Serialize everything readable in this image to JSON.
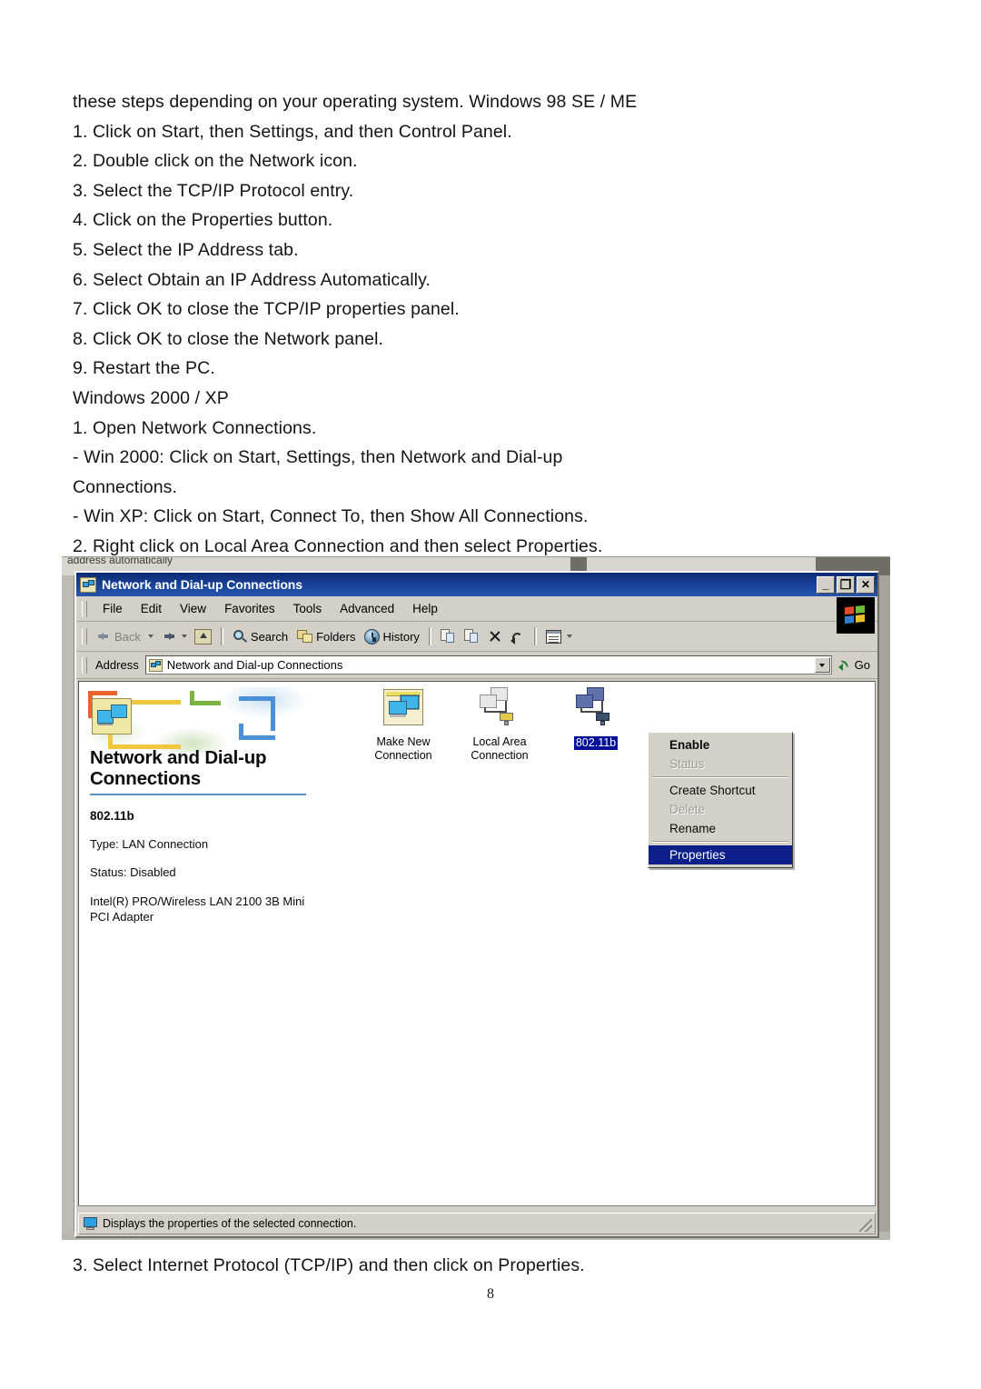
{
  "document": {
    "lines_top": [
      "these steps depending on your operating system. Windows 98 SE / ME",
      "1. Click on Start, then Settings, and then Control Panel.",
      "2. Double click on the Network icon.",
      "3. Select the TCP/IP Protocol entry.",
      "4. Click on the Properties button.",
      "5. Select the IP Address tab.",
      "6. Select Obtain an IP Address Automatically.",
      "7. Click OK to close the TCP/IP properties panel.",
      "8. Click OK to close the Network panel.",
      "9. Restart the PC.",
      "Windows 2000 / XP",
      "1. Open Network Connections.",
      "- Win 2000: Click on Start, Settings, then Network and Dial-up",
      "Connections.",
      "- Win XP: Click on Start, Connect To, then Show All Connections.",
      "2. Right click on Local Area Connection and then select Properties."
    ],
    "lines_bottom": [
      "3. Select Internet Protocol (TCP/IP) and then click on Properties."
    ],
    "page_number": "8"
  },
  "background_window": {
    "fragment_text": "address automatically"
  },
  "window": {
    "title": "Network and Dial-up Connections",
    "title_icon": "network-connections-icon",
    "controls": {
      "minimize": "_",
      "maximize": "❐",
      "close": "✕"
    },
    "menu": [
      {
        "label": "File"
      },
      {
        "label": "Edit"
      },
      {
        "label": "View"
      },
      {
        "label": "Favorites"
      },
      {
        "label": "Tools"
      },
      {
        "label": "Advanced"
      },
      {
        "label": "Help"
      }
    ],
    "toolbar": {
      "back": "Back",
      "search": "Search",
      "folders": "Folders",
      "history": "History"
    },
    "address": {
      "label": "Address",
      "value": "Network and Dial-up Connections",
      "go": "Go"
    },
    "left_pane": {
      "banner_title": "Network and Dial-up Connections",
      "detail_title": "802.11b",
      "detail_type": "Type: LAN Connection",
      "detail_status": "Status: Disabled",
      "detail_adapter": "Intel(R) PRO/Wireless LAN 2100 3B Mini PCI Adapter"
    },
    "connections": [
      {
        "name": "Make New Connection",
        "selected": false
      },
      {
        "name": "Local Area Connection",
        "selected": false
      },
      {
        "name": "802.11b",
        "selected": true
      }
    ],
    "context_menu": [
      {
        "label": "Enable",
        "state": "bold"
      },
      {
        "label": "Status",
        "state": "disabled"
      },
      {
        "label": "separator",
        "state": "separator"
      },
      {
        "label": "Create Shortcut",
        "state": "normal"
      },
      {
        "label": "Delete",
        "state": "disabled"
      },
      {
        "label": "Rename",
        "state": "normal"
      },
      {
        "label": "separator",
        "state": "separator"
      },
      {
        "label": "Properties",
        "state": "highlight"
      }
    ],
    "status_bar": {
      "text": "Displays the properties of the selected connection."
    }
  },
  "colors": {
    "titlebar": "#15419b",
    "selection": "#000f9a",
    "menu_highlight": "#0d1f8a",
    "window_face": "#d4d0c8",
    "banner_rule": "#5b8ec4"
  }
}
